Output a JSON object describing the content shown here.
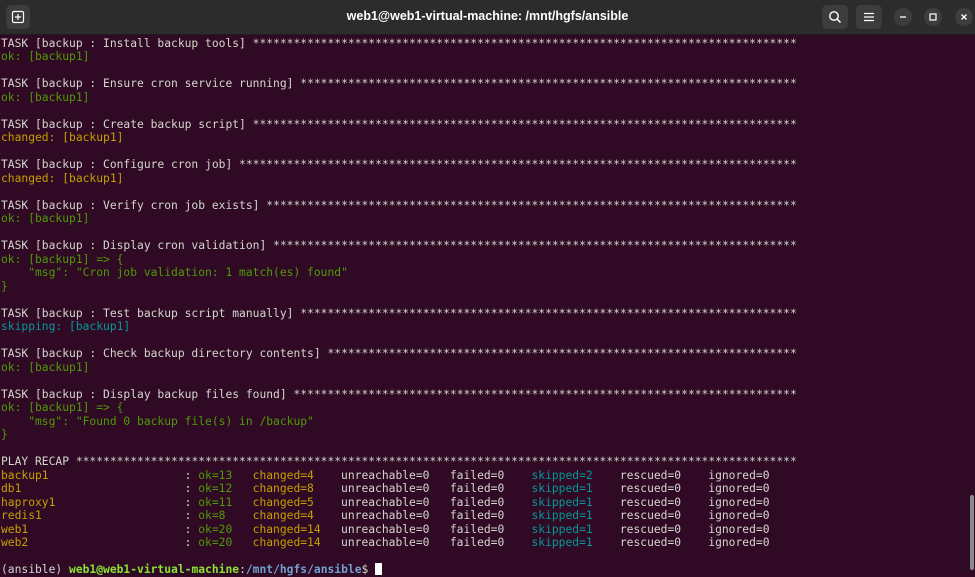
{
  "window": {
    "title": "web1@web1-virtual-machine: /mnt/hgfs/ansible"
  },
  "tasks": [
    {
      "header": "TASK [backup : Install backup tools] ",
      "status": "ok: [backup1]"
    },
    {
      "header": "TASK [backup : Ensure cron service running] ",
      "status": "ok: [backup1]"
    },
    {
      "header": "TASK [backup : Create backup script] ",
      "status": "changed: [backup1]"
    },
    {
      "header": "TASK [backup : Configure cron job] ",
      "status": "changed: [backup1]"
    },
    {
      "header": "TASK [backup : Verify cron job exists] ",
      "status": "ok: [backup1]"
    },
    {
      "header": "TASK [backup : Display cron validation] ",
      "status": "ok: [backup1] => {",
      "msg": "    \"msg\": \"Cron job validation: 1 match(es) found\"",
      "close": "}"
    },
    {
      "header": "TASK [backup : Test backup script manually] ",
      "status": "skipping: [backup1]"
    },
    {
      "header": "TASK [backup : Check backup directory contents] ",
      "status": "ok: [backup1]"
    },
    {
      "header": "TASK [backup : Display backup files found] ",
      "status": "ok: [backup1] => {",
      "msg": "    \"msg\": \"Found 0 backup file(s) in /backup\"",
      "close": "}"
    }
  ],
  "recap": {
    "header": "PLAY RECAP ",
    "rows": [
      {
        "host": "backup1",
        "ok": "ok=13",
        "changed": "changed=4",
        "unreachable": "unreachable=0",
        "failed": "failed=0",
        "skipped": "skipped=2",
        "rescued": "rescued=0",
        "ignored": "ignored=0"
      },
      {
        "host": "db1",
        "ok": "ok=12",
        "changed": "changed=8",
        "unreachable": "unreachable=0",
        "failed": "failed=0",
        "skipped": "skipped=1",
        "rescued": "rescued=0",
        "ignored": "ignored=0"
      },
      {
        "host": "haproxy1",
        "ok": "ok=11",
        "changed": "changed=5",
        "unreachable": "unreachable=0",
        "failed": "failed=0",
        "skipped": "skipped=1",
        "rescued": "rescued=0",
        "ignored": "ignored=0"
      },
      {
        "host": "redis1",
        "ok": "ok=8",
        "changed": "changed=4",
        "unreachable": "unreachable=0",
        "failed": "failed=0",
        "skipped": "skipped=1",
        "rescued": "rescued=0",
        "ignored": "ignored=0"
      },
      {
        "host": "web1",
        "ok": "ok=20",
        "changed": "changed=14",
        "unreachable": "unreachable=0",
        "failed": "failed=0",
        "skipped": "skipped=1",
        "rescued": "rescued=0",
        "ignored": "ignored=0"
      },
      {
        "host": "web2",
        "ok": "ok=20",
        "changed": "changed=14",
        "unreachable": "unreachable=0",
        "failed": "failed=0",
        "skipped": "skipped=1",
        "rescued": "rescued=0",
        "ignored": "ignored=0"
      }
    ]
  },
  "prompt": {
    "venv": "(ansible) ",
    "user_host": "web1@web1-virtual-machine",
    "colon": ":",
    "path": "/mnt/hgfs/ansible",
    "symbol": "$ "
  },
  "colors": {
    "background": "#300a24",
    "ok": "#4e9a06",
    "changed": "#c4a000",
    "skipped": "#06989a",
    "text": "#d3d7cf"
  }
}
